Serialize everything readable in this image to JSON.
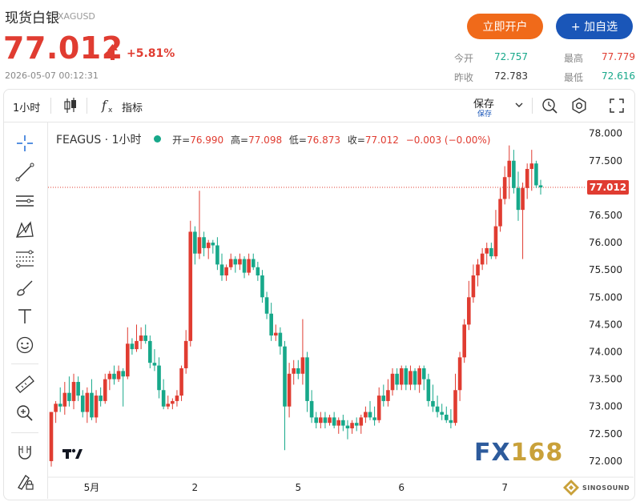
{
  "header": {
    "name": "现货白银",
    "symbol": "XAGUSD",
    "price": "77.012",
    "change_pct": "+5.81%",
    "timestamp": "2026-05-07 00:12:31",
    "btn_open": "立即开户",
    "btn_watch": "+ 加自选"
  },
  "stats": {
    "open_label": "今开",
    "open": "72.757",
    "high_label": "最高",
    "high": "77.779",
    "prev_label": "昨收",
    "prev": "72.783",
    "low_label": "最低",
    "low": "72.616"
  },
  "toolbar": {
    "interval": "1小时",
    "indicators": "指标",
    "save": "保存",
    "save_sub": "保存"
  },
  "colors": {
    "up": "#e03c31",
    "down": "#17a88a",
    "accent_orange": "#f06a1a",
    "accent_blue": "#1a56b8"
  },
  "legend": {
    "name": "FEAGUS · 1小时",
    "open_label": "开=",
    "open": "76.990",
    "high_label": "高=",
    "high": "77.098",
    "low_label": "低=",
    "low": "76.873",
    "close_label": "收=",
    "close": "77.012",
    "change": "−0.003 (−0.00%)"
  },
  "logo_text": {
    "fx": "FX",
    "num": "168",
    "sub": "SINOSOUND"
  },
  "chart_data": {
    "type": "candlestick",
    "symbol": "FEAGUS",
    "interval": "1小时",
    "y_ticks": [
      "78.000",
      "77.500",
      "77.000",
      "76.500",
      "76.000",
      "75.500",
      "75.000",
      "74.500",
      "74.000",
      "73.500",
      "73.000",
      "72.500",
      "72.000"
    ],
    "ylim": [
      71.75,
      78.2
    ],
    "x_ticks": [
      {
        "label": "5月",
        "i": 9
      },
      {
        "label": "2",
        "i": 32
      },
      {
        "label": "5",
        "i": 55
      },
      {
        "label": "6",
        "i": 78
      },
      {
        "label": "7",
        "i": 101
      }
    ],
    "last_price": "77.012",
    "candles": [
      [
        72.0,
        72.9,
        71.9,
        72.9
      ],
      [
        72.9,
        73.1,
        72.7,
        73.05
      ],
      [
        73.05,
        73.35,
        72.9,
        73.0
      ],
      [
        73.0,
        73.45,
        72.85,
        73.25
      ],
      [
        73.25,
        73.55,
        73.0,
        73.1
      ],
      [
        73.1,
        73.6,
        72.95,
        73.45
      ],
      [
        73.45,
        73.55,
        73.1,
        73.2
      ],
      [
        73.2,
        73.3,
        72.8,
        72.9
      ],
      [
        72.9,
        73.35,
        72.7,
        73.25
      ],
      [
        73.25,
        73.5,
        72.75,
        72.8
      ],
      [
        72.8,
        73.3,
        72.7,
        73.2
      ],
      [
        73.2,
        73.35,
        73.0,
        73.1
      ],
      [
        73.1,
        73.6,
        73.05,
        73.5
      ],
      [
        73.5,
        73.65,
        73.3,
        73.6
      ],
      [
        73.6,
        73.75,
        73.4,
        73.5
      ],
      [
        73.5,
        73.75,
        73.45,
        73.65
      ],
      [
        73.65,
        73.7,
        73.0,
        73.55
      ],
      [
        73.55,
        74.45,
        73.5,
        74.15
      ],
      [
        74.15,
        74.25,
        73.95,
        74.05
      ],
      [
        74.05,
        74.5,
        74.0,
        74.2
      ],
      [
        74.2,
        74.45,
        74.05,
        74.3
      ],
      [
        74.3,
        74.5,
        74.15,
        74.2
      ],
      [
        74.2,
        74.3,
        73.7,
        73.8
      ],
      [
        73.8,
        74.05,
        73.65,
        73.75
      ],
      [
        73.75,
        73.9,
        73.15,
        73.3
      ],
      [
        73.3,
        73.5,
        72.95,
        73.0
      ],
      [
        73.0,
        73.2,
        72.95,
        73.05
      ],
      [
        73.05,
        73.15,
        72.95,
        73.1
      ],
      [
        73.1,
        73.3,
        73.0,
        73.2
      ],
      [
        73.2,
        73.75,
        73.1,
        73.7
      ],
      [
        73.7,
        74.4,
        73.6,
        74.2
      ],
      [
        74.2,
        76.4,
        74.1,
        76.2
      ],
      [
        76.2,
        76.3,
        75.6,
        75.8
      ],
      [
        75.8,
        76.95,
        75.7,
        76.1
      ],
      [
        76.1,
        76.2,
        75.75,
        75.9
      ],
      [
        75.9,
        76.05,
        75.7,
        76.0
      ],
      [
        76.0,
        76.05,
        75.8,
        75.95
      ],
      [
        75.95,
        76.1,
        75.5,
        75.6
      ],
      [
        75.6,
        75.8,
        75.3,
        75.4
      ],
      [
        75.4,
        75.6,
        75.3,
        75.55
      ],
      [
        75.55,
        75.8,
        75.5,
        75.7
      ],
      [
        75.7,
        75.75,
        75.45,
        75.6
      ],
      [
        75.6,
        75.8,
        75.5,
        75.7
      ],
      [
        75.7,
        75.75,
        75.35,
        75.45
      ],
      [
        75.45,
        75.8,
        75.4,
        75.7
      ],
      [
        75.7,
        75.8,
        75.5,
        75.55
      ],
      [
        75.55,
        75.65,
        75.3,
        75.4
      ],
      [
        75.4,
        75.5,
        74.9,
        75.0
      ],
      [
        75.0,
        75.1,
        74.6,
        74.7
      ],
      [
        74.7,
        74.9,
        74.2,
        74.3
      ],
      [
        74.3,
        74.5,
        74.2,
        74.35
      ],
      [
        74.35,
        74.45,
        73.95,
        74.1
      ],
      [
        74.1,
        74.2,
        72.2,
        73.0
      ],
      [
        73.0,
        73.8,
        72.8,
        73.6
      ],
      [
        73.6,
        73.85,
        73.4,
        73.7
      ],
      [
        73.7,
        73.85,
        73.5,
        73.6
      ],
      [
        73.6,
        74.6,
        73.4,
        73.9
      ],
      [
        73.9,
        74.0,
        72.9,
        73.1
      ],
      [
        73.1,
        73.3,
        72.7,
        72.8
      ],
      [
        72.8,
        72.9,
        72.6,
        72.7
      ],
      [
        72.7,
        72.9,
        72.6,
        72.8
      ],
      [
        72.8,
        72.9,
        72.6,
        72.7
      ],
      [
        72.7,
        72.85,
        72.65,
        72.8
      ],
      [
        72.8,
        72.9,
        72.6,
        72.65
      ],
      [
        72.65,
        72.8,
        72.5,
        72.75
      ],
      [
        72.75,
        72.85,
        72.55,
        72.65
      ],
      [
        72.65,
        72.75,
        72.4,
        72.6
      ],
      [
        72.6,
        72.75,
        72.5,
        72.7
      ],
      [
        72.7,
        72.8,
        72.55,
        72.65
      ],
      [
        72.65,
        72.85,
        72.5,
        72.8
      ],
      [
        72.8,
        73.0,
        72.7,
        72.9
      ],
      [
        72.9,
        73.1,
        72.75,
        72.8
      ],
      [
        72.8,
        73.0,
        72.65,
        72.75
      ],
      [
        72.75,
        73.35,
        72.7,
        73.2
      ],
      [
        73.2,
        73.4,
        73.0,
        73.1
      ],
      [
        73.1,
        73.5,
        73.0,
        73.3
      ],
      [
        73.3,
        73.7,
        73.2,
        73.6
      ],
      [
        73.6,
        73.7,
        73.3,
        73.4
      ],
      [
        73.4,
        73.75,
        73.3,
        73.7
      ],
      [
        73.7,
        73.75,
        73.3,
        73.4
      ],
      [
        73.4,
        73.75,
        73.3,
        73.65
      ],
      [
        73.65,
        73.7,
        73.3,
        73.4
      ],
      [
        73.4,
        73.75,
        73.25,
        73.7
      ],
      [
        73.7,
        73.75,
        73.3,
        73.5
      ],
      [
        73.5,
        73.6,
        73.0,
        73.1
      ],
      [
        73.1,
        73.4,
        72.9,
        73.0
      ],
      [
        73.0,
        73.2,
        72.8,
        72.9
      ],
      [
        72.9,
        73.05,
        72.75,
        72.85
      ],
      [
        72.85,
        73.0,
        72.7,
        72.75
      ],
      [
        72.75,
        72.95,
        72.6,
        72.7
      ],
      [
        72.7,
        73.6,
        72.65,
        73.3
      ],
      [
        73.3,
        74.0,
        73.1,
        73.9
      ],
      [
        73.9,
        74.6,
        73.8,
        74.5
      ],
      [
        74.5,
        75.3,
        74.4,
        75.0
      ],
      [
        75.0,
        75.6,
        74.9,
        75.4
      ],
      [
        75.4,
        75.7,
        75.2,
        75.6
      ],
      [
        75.6,
        75.9,
        75.5,
        75.8
      ],
      [
        75.8,
        76.0,
        75.6,
        75.9
      ],
      [
        75.9,
        76.0,
        75.7,
        75.75
      ],
      [
        75.75,
        76.6,
        75.7,
        76.3
      ],
      [
        76.3,
        77.0,
        76.2,
        76.8
      ],
      [
        76.8,
        77.4,
        76.7,
        77.2
      ],
      [
        77.2,
        77.78,
        76.8,
        77.5
      ],
      [
        77.5,
        77.7,
        76.9,
        77.0
      ],
      [
        77.0,
        77.3,
        76.4,
        76.6
      ],
      [
        76.6,
        77.1,
        75.7,
        77.0
      ],
      [
        77.0,
        77.45,
        76.8,
        77.35
      ],
      [
        77.35,
        77.7,
        76.95,
        77.45
      ],
      [
        77.45,
        77.5,
        77.0,
        77.05
      ],
      [
        77.05,
        77.15,
        76.88,
        77.012
      ]
    ]
  }
}
